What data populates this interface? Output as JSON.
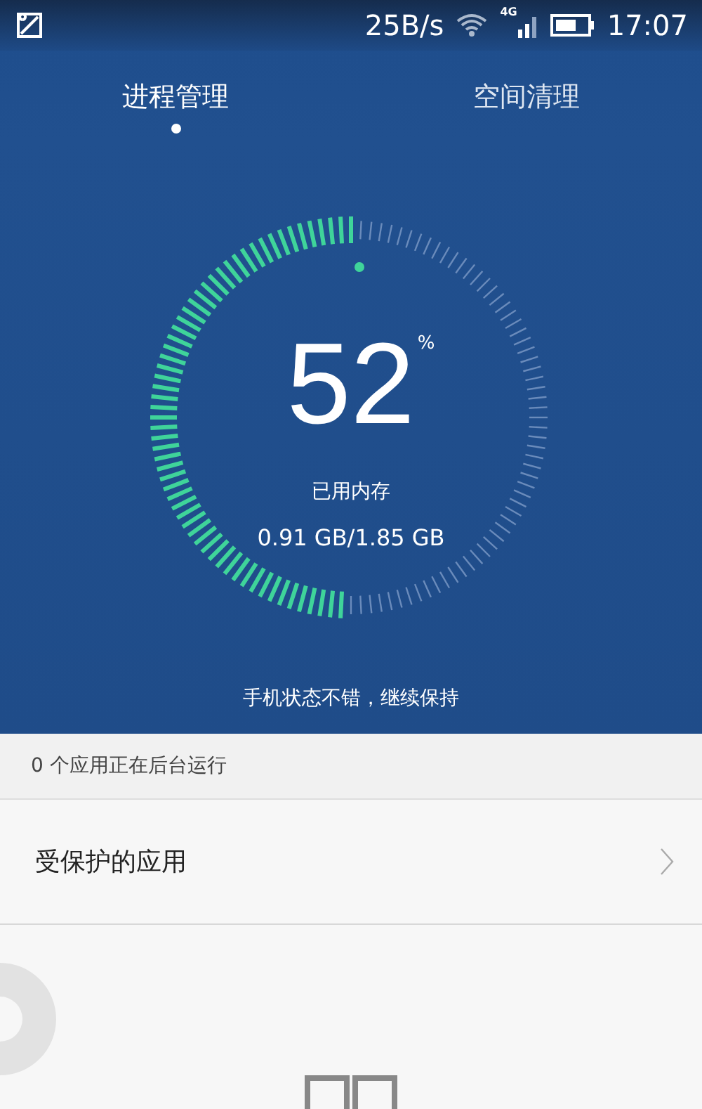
{
  "status_bar": {
    "speed": "25B/s",
    "network": "4G",
    "time": "17:07"
  },
  "tabs": [
    {
      "label": "进程管理",
      "selected": true
    },
    {
      "label": "空间清理",
      "selected": false
    }
  ],
  "gauge": {
    "value": "52",
    "unit": "%",
    "label": "已用内存",
    "usage": "0.91 GB/1.85 GB"
  },
  "status_message": "手机状态不错，继续保持",
  "background_info": "0 个应用正在后台运行",
  "menu_items": [
    {
      "label": "受保护的应用"
    }
  ]
}
